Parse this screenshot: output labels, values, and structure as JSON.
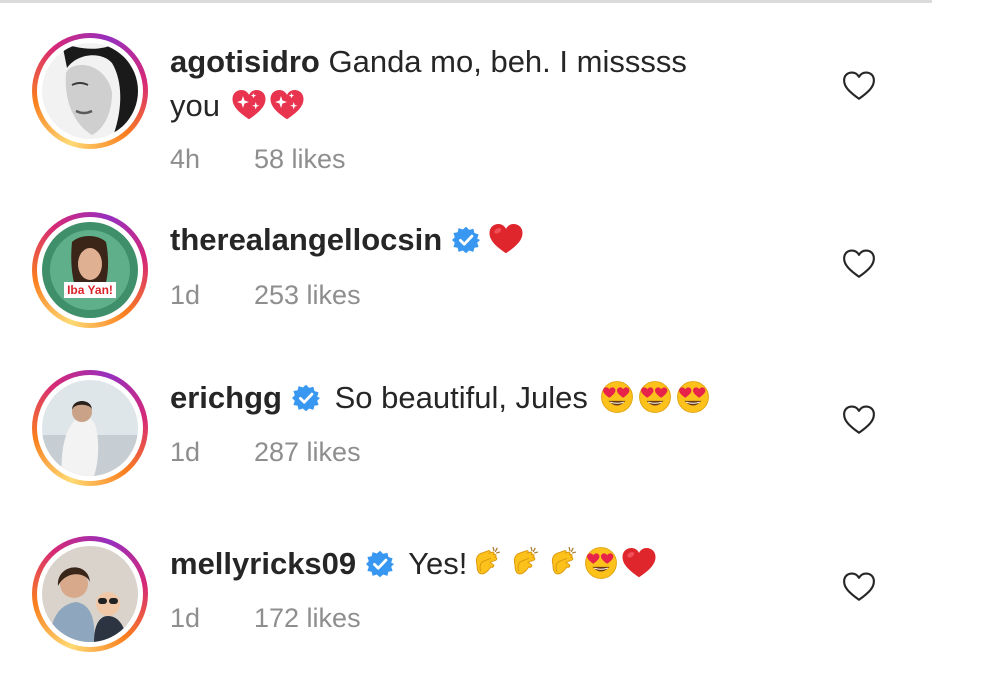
{
  "comments": [
    {
      "username": "agotisidro",
      "text_1": "Ganda mo, beh. I misssss",
      "text_2": "you",
      "emojis": [
        "sparkling-heart",
        "sparkling-heart"
      ],
      "verified": false,
      "time": "4h",
      "likes": "58 likes"
    },
    {
      "username": "therealangellocsin",
      "text": "",
      "emojis": [
        "red-heart"
      ],
      "verified": true,
      "avatar_badge": "Iba Yan!",
      "time": "1d",
      "likes": "253 likes"
    },
    {
      "username": "erichgg",
      "text": "So beautiful, Jules",
      "emojis": [
        "heart-eyes",
        "heart-eyes",
        "heart-eyes"
      ],
      "verified": true,
      "time": "1d",
      "likes": "287 likes"
    },
    {
      "username": "mellyricks09",
      "text": "Yes!",
      "emojis": [
        "clapping-hands",
        "clapping-hands",
        "clapping-hands",
        "heart-eyes",
        "red-heart"
      ],
      "verified": true,
      "time": "1d",
      "likes": "172 likes"
    }
  ],
  "colors": {
    "text": "#262626",
    "meta": "#8e8e8e",
    "verified": "#3897f0",
    "heart": "#ed2d3a"
  }
}
